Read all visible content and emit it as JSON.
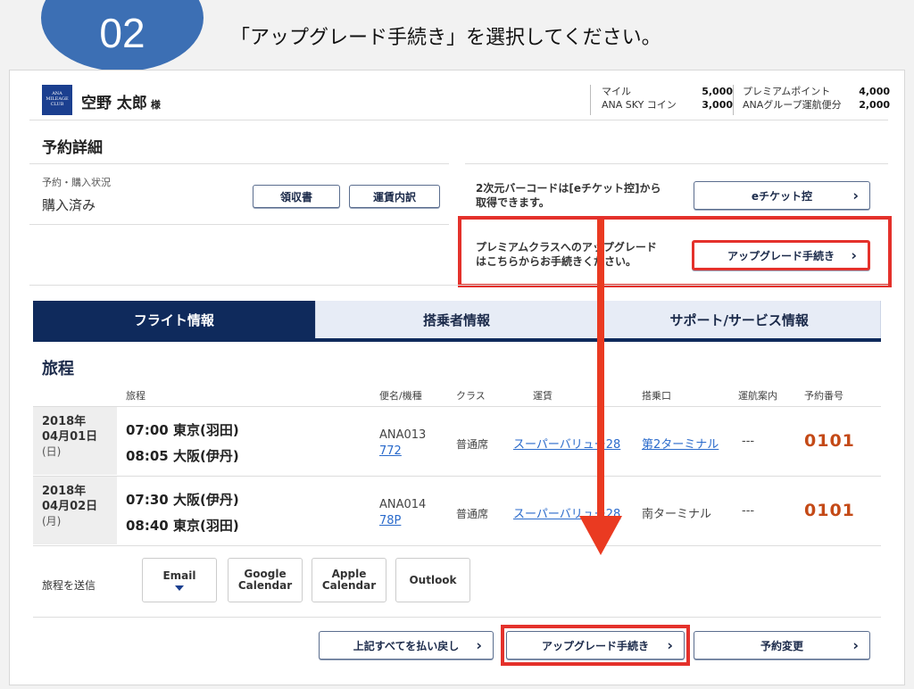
{
  "step": {
    "number": "02",
    "instruction": "「アップグレード手続き」を選択してください。"
  },
  "header": {
    "logo_text": "ANA MILEAGE CLUB",
    "user_name": "空野 太郎",
    "user_suffix": "様",
    "miles_label": "マイル",
    "miles_value": "5,000",
    "skycoin_label": "ANA SKY コイン",
    "skycoin_value": "3,000",
    "premium_label": "プレミアムポイント",
    "premium_value": "4,000",
    "group_label": "ANAグループ運航便分",
    "group_value": "2,000"
  },
  "reservation": {
    "title": "予約詳細",
    "status_label": "予約・購入状況",
    "status_value": "購入済み",
    "receipt_button": "領収書",
    "fare_detail_button": "運賃内訳",
    "barcode_text_line1": "2次元バーコードは[eチケット控]から",
    "barcode_text_line2": "取得できます。",
    "eticket_button": "eチケット控",
    "upgrade_text_line1": "プレミアムクラスへのアップグレード",
    "upgrade_text_line2": "はこちらからお手続きください。",
    "upgrade_button": "アップグレード手続き"
  },
  "tabs": [
    {
      "label": "フライト情報",
      "active": true
    },
    {
      "label": "搭乗者情報",
      "active": false
    },
    {
      "label": "サポート/サービス情報",
      "active": false
    }
  ],
  "itinerary": {
    "title": "旅程",
    "headers": {
      "route": "旅程",
      "flight": "便名/機種",
      "class": "クラス",
      "fare": "運賃",
      "gate": "搭乗口",
      "ops": "運航案内",
      "resno": "予約番号"
    },
    "rows": [
      {
        "year": "2018年",
        "date": "04月01日",
        "dow": "(日)",
        "dep": "07:00  東京(羽田)",
        "arr": "08:05  大阪(伊丹)",
        "flight": "ANA013",
        "equip": "772",
        "class": "普通席",
        "fare": "スーパーバリュー28",
        "gate": "第2ターミナル",
        "ops": "---",
        "resno": "0101"
      },
      {
        "year": "2018年",
        "date": "04月02日",
        "dow": "(月)",
        "dep": "07:30  大阪(伊丹)",
        "arr": "08:40  東京(羽田)",
        "flight": "ANA014",
        "equip": "78P",
        "class": "普通席",
        "fare": "スーパーバリュー28",
        "gate": "南ターミナル",
        "ops": "---",
        "resno": "0101"
      }
    ]
  },
  "send": {
    "label": "旅程を送信",
    "email": "Email",
    "google": "Google Calendar",
    "apple": "Apple Calendar",
    "outlook": "Outlook"
  },
  "footer": {
    "refund_button": "上記すべてを払い戻し",
    "upgrade_button": "アップグレード手続き",
    "change_button": "予約変更"
  },
  "colors": {
    "accent_red": "#e4312b",
    "navy": "#0f2a5c",
    "circle_blue": "#3c6fb4",
    "resno_orange": "#c44a17"
  }
}
